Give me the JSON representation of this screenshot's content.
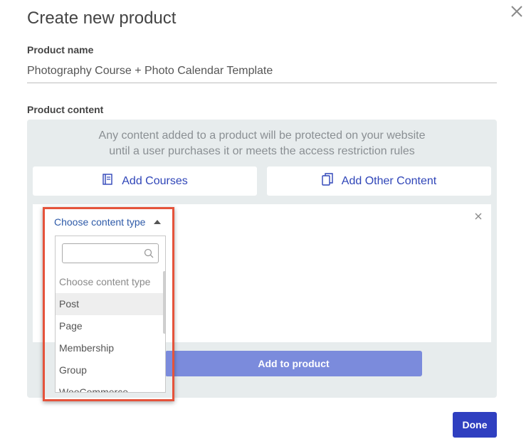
{
  "dialog": {
    "title": "Create new product",
    "product_name_label": "Product name",
    "product_name_value": "Photography Course + Photo Calendar Template",
    "product_content_label": "Product content",
    "info_line1": "Any content added to a product will be protected on your website",
    "info_line2": "until a user purchases it or meets the access restriction rules",
    "add_courses_label": "Add Courses",
    "add_other_content_label": "Add Other Content",
    "add_to_product_label": "Add to product",
    "done_label": "Done",
    "close_icon": "close-icon"
  },
  "content_type_select": {
    "selected": "Choose content type",
    "search_placeholder": "",
    "options": [
      {
        "label": "Choose content type",
        "state": "placeholder"
      },
      {
        "label": "Post",
        "state": "hover"
      },
      {
        "label": "Page",
        "state": "normal"
      },
      {
        "label": "Membership",
        "state": "normal"
      },
      {
        "label": "Group",
        "state": "normal"
      },
      {
        "label": "WooCommerce",
        "state": "normal"
      }
    ]
  },
  "colors": {
    "accent": "#2f45b8",
    "done_button": "#2f3fc0",
    "add_to_product_button": "#7b8bdc",
    "highlight_border": "#e5533b",
    "panel_bg": "#e7eced"
  }
}
